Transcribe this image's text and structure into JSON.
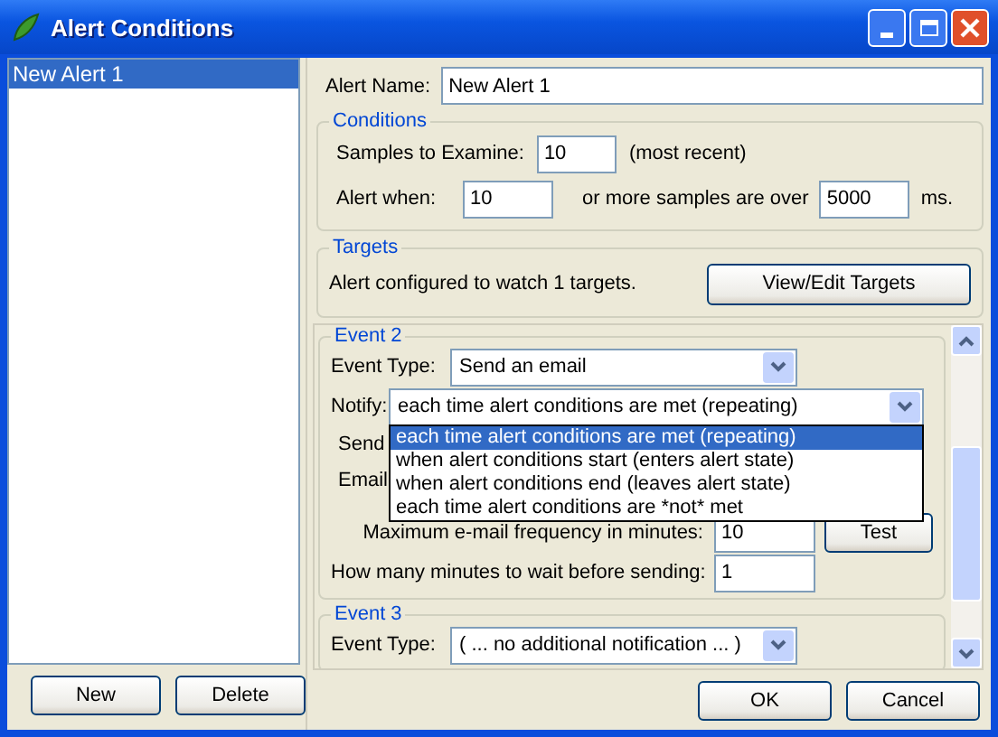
{
  "window": {
    "title": "Alert Conditions"
  },
  "alerts": [
    {
      "label": "New Alert 1",
      "selected": true
    }
  ],
  "left_buttons": [
    "New",
    "Delete"
  ],
  "alert_name": {
    "label": "Alert Name:",
    "value": "New Alert 1"
  },
  "conditions": {
    "title": "Conditions",
    "samples_label": "Samples to Examine:",
    "samples_value": "10",
    "samples_note": "(most recent)",
    "alert_when_label": "Alert when:",
    "count_value": "10",
    "middle_text": "or more samples are over",
    "threshold_value": "5000",
    "unit": "ms."
  },
  "targets": {
    "title": "Targets",
    "text": "Alert configured to watch 1 targets.",
    "button": "View/Edit Targets"
  },
  "events": [
    {
      "kind": "email",
      "title": "Event 2",
      "event_type_label": "Event Type:",
      "event_type_value": "Send an email",
      "notify_label": "Notify:",
      "notify_value": "each time alert conditions are met (repeating)",
      "notify_open": true,
      "notify_options": [
        {
          "label": "each time alert conditions are met (repeating)",
          "selected": true
        },
        {
          "label": "when alert conditions start (enters alert state)",
          "selected": false
        },
        {
          "label": "when alert conditions end (leaves alert state)",
          "selected": false
        },
        {
          "label": "each time alert conditions are *not* met",
          "selected": false
        }
      ],
      "send_label": "Send",
      "email_label": "Email",
      "max_freq_label": "Maximum e-mail frequency in minutes:",
      "max_freq_value": "10",
      "test_button": "Test",
      "wait_label": "How many minutes to wait before sending:",
      "wait_value": "1"
    },
    {
      "kind": "none",
      "title": "Event 3",
      "event_type_label": "Event Type:",
      "event_type_value": "( ... no additional notification ... )"
    }
  ],
  "footer_buttons": [
    "OK",
    "Cancel"
  ]
}
